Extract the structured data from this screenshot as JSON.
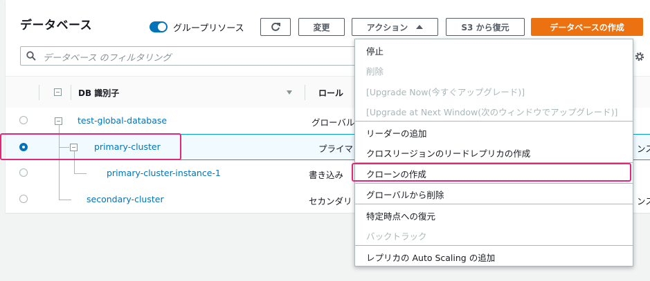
{
  "header": {
    "title": "データベース",
    "group_toggle_label": "グループリソース",
    "refresh_label": "↻",
    "modify_label": "変更",
    "actions_label": "アクション",
    "restore_s3_label": "S3 から復元",
    "create_label": "データベースの作成"
  },
  "search": {
    "placeholder": "データベース のフィルタリング"
  },
  "table": {
    "columns": {
      "db_id": "DB 識別子",
      "role": "ロール"
    },
    "rows": [
      {
        "name": "test-global-database",
        "role": "グローバル",
        "extra": ""
      },
      {
        "name": "primary-cluster",
        "role": "プライマリ",
        "extra": "ンス"
      },
      {
        "name": "primary-cluster-instance-1",
        "role": "書き込み",
        "extra": ""
      },
      {
        "name": "secondary-cluster",
        "role": "セカンダリ",
        "extra": "ンス"
      }
    ]
  },
  "actions_menu": {
    "items": [
      "停止",
      "削除",
      "[Upgrade Now(今すぐアップグレード)]",
      "[Upgrade at Next Window(次のウィンドウでアップグレード)]",
      "リーダーの追加",
      "クロスリージョンのリードレプリカの作成",
      "クローンの作成",
      "グローバルから削除",
      "特定時点への復元",
      "バックトラック",
      "レプリカの Auto Scaling の追加"
    ]
  },
  "colors": {
    "accent": "#0073bb",
    "primary_button": "#ec7211",
    "highlight": "#e3267b"
  }
}
